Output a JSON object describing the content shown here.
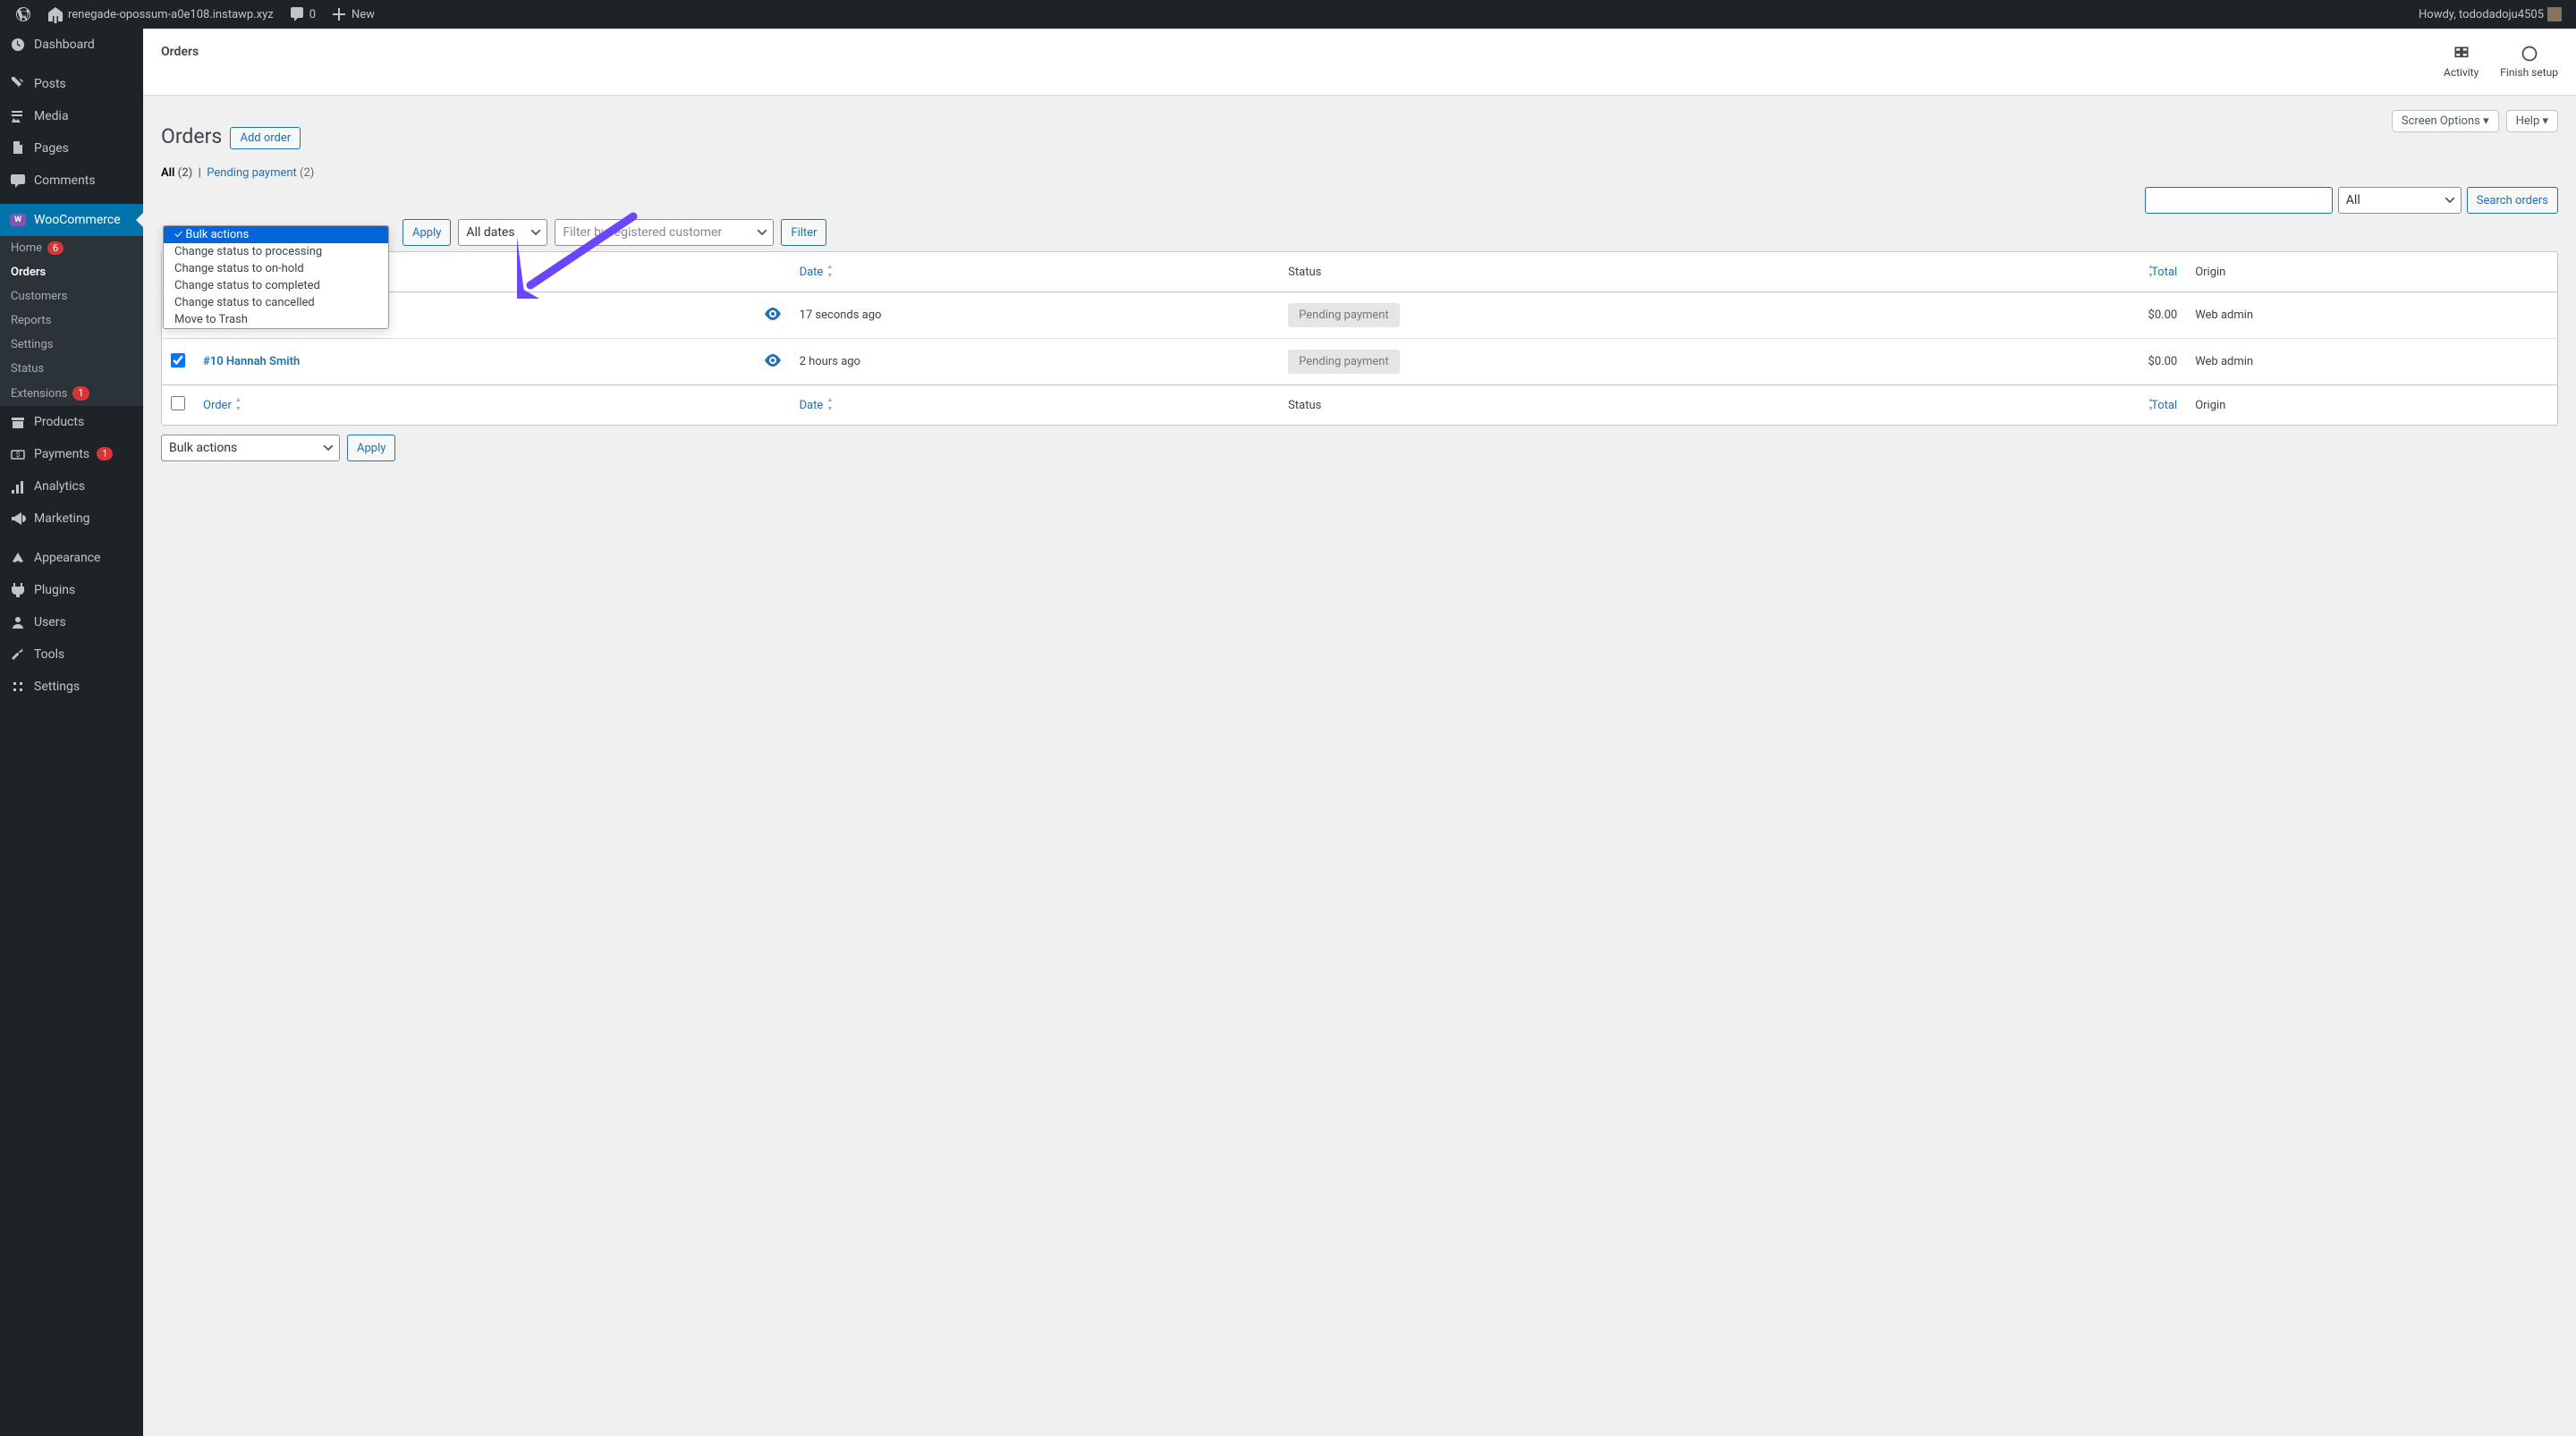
{
  "adminBar": {
    "siteName": "renegade-opossum-a0e108.instawp.xyz",
    "commentCount": "0",
    "newLabel": "New",
    "greeting": "Howdy, tododadoju4505"
  },
  "sidebar": {
    "items": [
      {
        "id": "dashboard",
        "label": "Dashboard"
      },
      {
        "id": "posts",
        "label": "Posts"
      },
      {
        "id": "media",
        "label": "Media"
      },
      {
        "id": "pages",
        "label": "Pages"
      },
      {
        "id": "comments",
        "label": "Comments"
      },
      {
        "id": "woocommerce",
        "label": "WooCommerce"
      },
      {
        "id": "products",
        "label": "Products"
      },
      {
        "id": "payments",
        "label": "Payments"
      },
      {
        "id": "analytics",
        "label": "Analytics"
      },
      {
        "id": "marketing",
        "label": "Marketing"
      },
      {
        "id": "appearance",
        "label": "Appearance"
      },
      {
        "id": "plugins",
        "label": "Plugins"
      },
      {
        "id": "users",
        "label": "Users"
      },
      {
        "id": "tools",
        "label": "Tools"
      },
      {
        "id": "settings",
        "label": "Settings"
      }
    ],
    "wooSubmenu": {
      "home": {
        "label": "Home",
        "badge": "6"
      },
      "orders": {
        "label": "Orders"
      },
      "customers": {
        "label": "Customers"
      },
      "reports": {
        "label": "Reports"
      },
      "settings": {
        "label": "Settings"
      },
      "status": {
        "label": "Status"
      },
      "extensions": {
        "label": "Extensions",
        "badge": "1"
      }
    },
    "paymentsBadge": "1"
  },
  "header": {
    "title": "Orders",
    "activity": "Activity",
    "finishSetup": "Finish setup",
    "screenOptions": "Screen Options",
    "help": "Help"
  },
  "page": {
    "heading": "Orders",
    "addOrder": "Add order",
    "filters": {
      "allLabel": "All",
      "allCount": "(2)",
      "pendingLabel": "Pending payment",
      "pendingCount": "(2)"
    },
    "bulkActions": {
      "label": "Bulk actions",
      "options": [
        "Bulk actions",
        "Change status to processing",
        "Change status to on-hold",
        "Change status to completed",
        "Change status to cancelled",
        "Move to Trash"
      ]
    },
    "apply": "Apply",
    "allDates": "All dates",
    "customerFilter": "Filter by registered customer",
    "categoryAll": "All",
    "filterBtn": "Filter",
    "searchOrders": "Search orders",
    "columns": {
      "order": "Order",
      "date": "Date",
      "status": "Status",
      "total": "Total",
      "origin": "Origin"
    },
    "rows": [
      {
        "order": "",
        "date": "17 seconds ago",
        "status": "Pending payment",
        "total": "$0.00",
        "origin": "Web admin",
        "checked": false
      },
      {
        "order": "#10 Hannah Smith",
        "date": "2 hours ago",
        "status": "Pending payment",
        "total": "$0.00",
        "origin": "Web admin",
        "checked": true
      }
    ]
  }
}
